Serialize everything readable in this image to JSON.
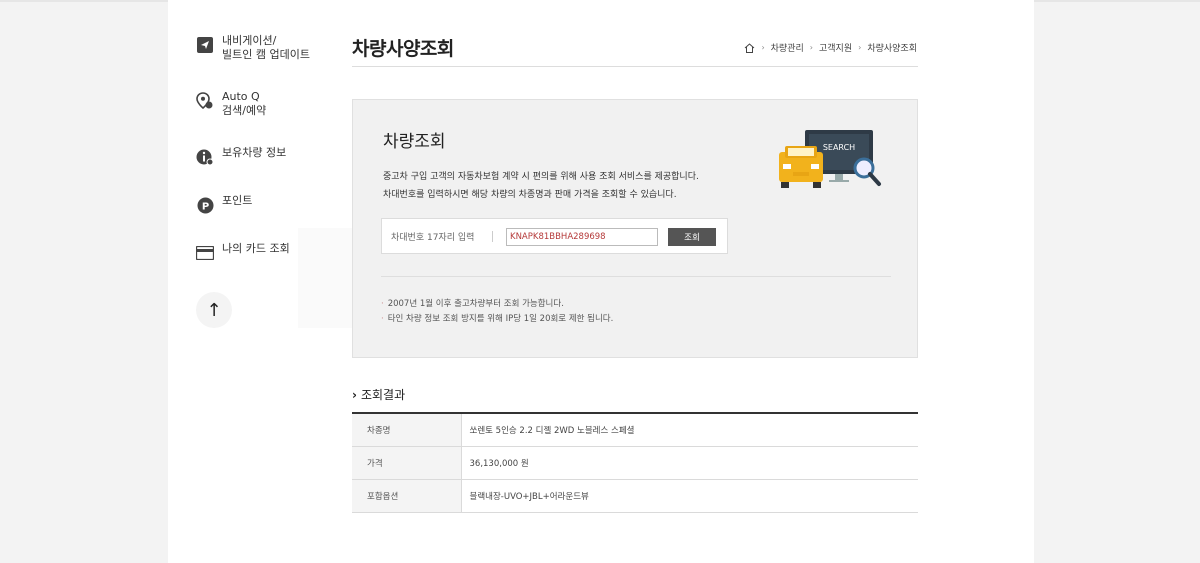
{
  "sidebar": {
    "items": [
      {
        "label_line1": "내비게이션/",
        "label_line2": "빌트인 캠 업데이트",
        "icon": "navigation-icon"
      },
      {
        "label_line1": "Auto Q",
        "label_line2": "검색/예약",
        "icon": "location-pin-icon"
      },
      {
        "label_line1": "보유차량 정보",
        "label_line2": "",
        "icon": "info-icon"
      },
      {
        "label_line1": "포인트",
        "label_line2": "",
        "icon": "point-icon"
      },
      {
        "label_line1": "나의 카드 조회",
        "label_line2": "",
        "icon": "card-icon"
      }
    ],
    "up_button": "↑"
  },
  "header": {
    "title": "차량사양조회",
    "breadcrumb": [
      "차량관리",
      "고객지원",
      "차량사양조회"
    ]
  },
  "lookup": {
    "title": "차량조회",
    "desc_line1": "중고차 구입 고객의 자동차보험 계약 시 편의를 위해 사용 조회 서비스를 제공합니다.",
    "desc_line2": "차대번호를 입력하시면 해당 차량의 차종명과 판매 가격을 조회할 수 있습니다.",
    "vin_label": "차대번호 17자리 입력",
    "vin_value": "KNAPK81BBHA289698",
    "search_button": "조회",
    "notes": [
      "2007년 1월 이후 출고차량부터 조회 가능합니다.",
      "타인 차량 정보 조회 방지를 위해 IP당 1일 20회로 제한 됩니다."
    ],
    "illustration_text": "SEARCH"
  },
  "result": {
    "title": "조회결과",
    "rows": [
      {
        "label": "차종명",
        "value": "쏘렌토 5인승 2.2 디젤 2WD 노블레스 스페셜"
      },
      {
        "label": "가격",
        "value": "36,130,000 원"
      },
      {
        "label": "포함옵션",
        "value": "블랙내장-UVO+JBL+어라운드뷰"
      }
    ]
  }
}
